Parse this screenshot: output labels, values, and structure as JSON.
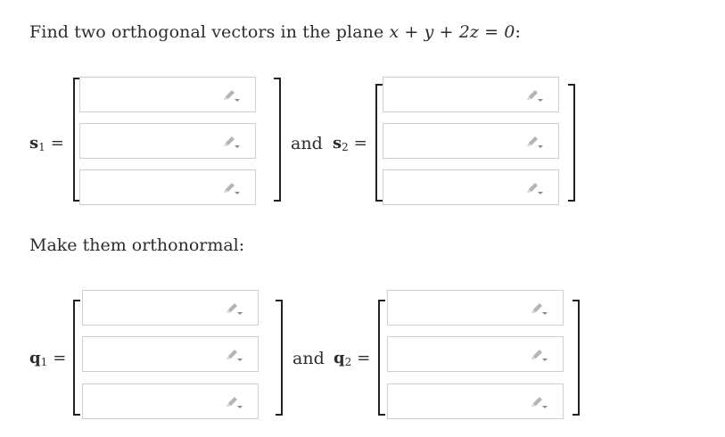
{
  "problem": {
    "text_before": "Find two orthogonal vectors in the plane ",
    "equation": "x + y + 2z = 0",
    "text_after": ":"
  },
  "section2": {
    "text": "Make them orthonormal:"
  },
  "labels": {
    "s1_base": "s",
    "s1_sub": "1",
    "s2_base": "s",
    "s2_sub": "2",
    "q1_base": "q",
    "q1_sub": "1",
    "q2_base": "q",
    "q2_sub": "2",
    "equals": "=",
    "and": "and"
  },
  "inputs": {
    "s1": [
      "",
      "",
      ""
    ],
    "s2": [
      "",
      "",
      ""
    ],
    "q1": [
      "",
      "",
      ""
    ],
    "q2": [
      "",
      "",
      ""
    ]
  },
  "icons": {
    "entry_tool": "pencil-dropdown-icon"
  },
  "colors": {
    "field_border": "#cfcfcf",
    "icon": "#b5b5b5",
    "text": "#2d2d2d"
  }
}
